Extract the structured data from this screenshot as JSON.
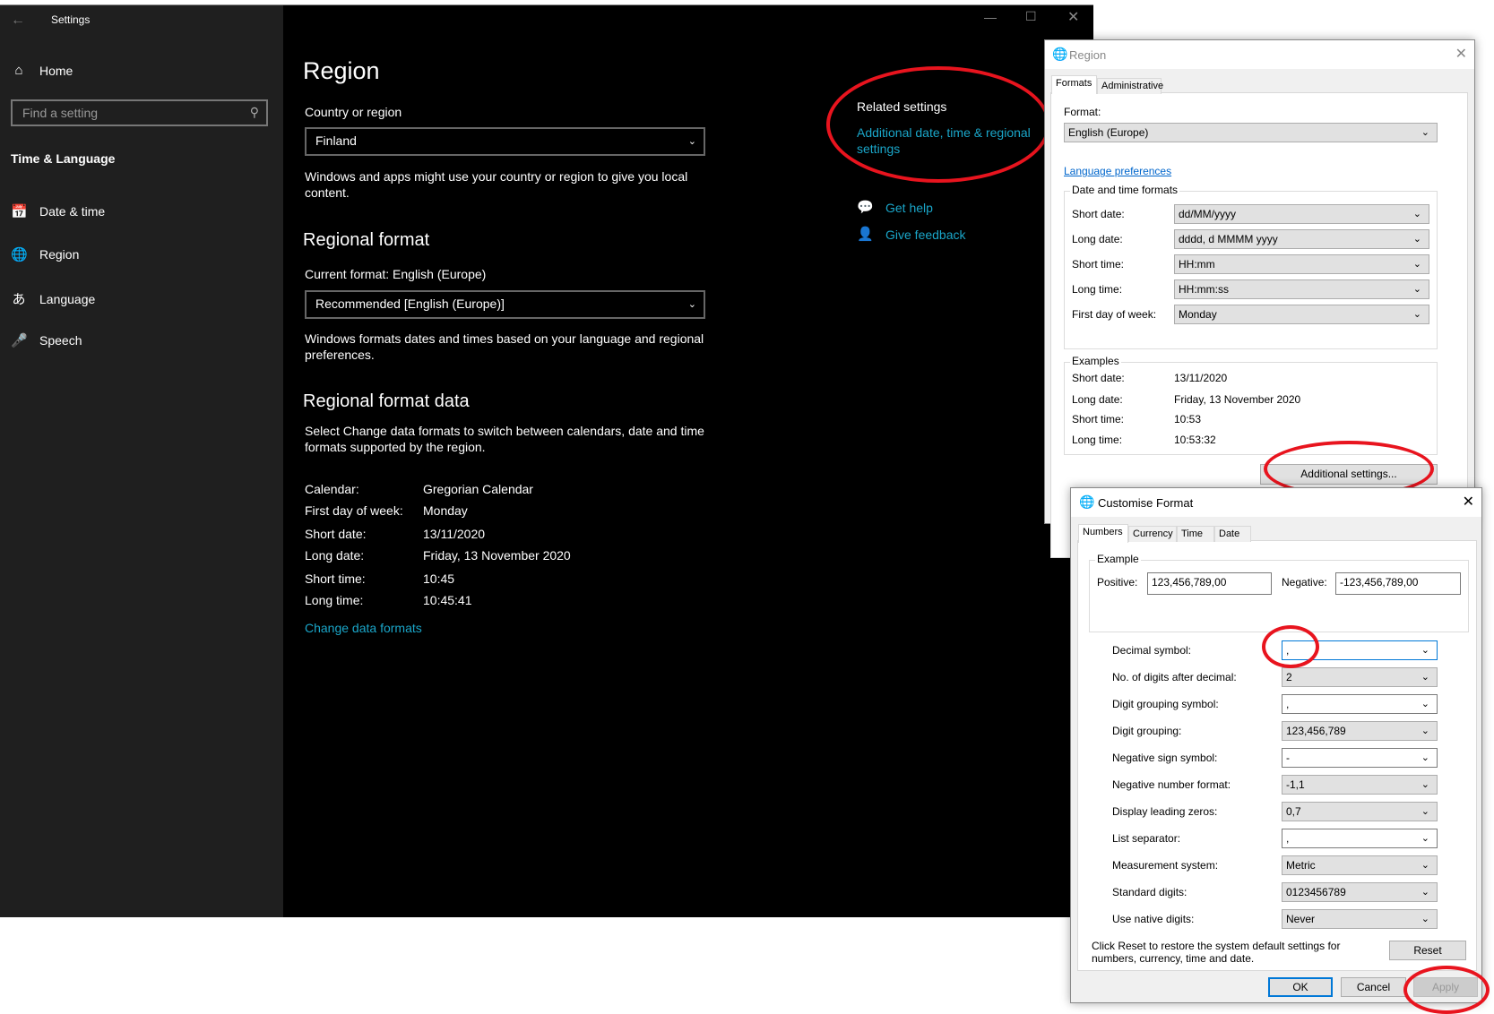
{
  "settings": {
    "title": "Settings",
    "search_placeholder": "Find a setting",
    "home": "Home",
    "section": "Time & Language",
    "nav": [
      {
        "label": "Date & time",
        "icon": "calendar-clock-icon"
      },
      {
        "label": "Region",
        "icon": "globe-icon"
      },
      {
        "label": "Language",
        "icon": "language-icon"
      },
      {
        "label": "Speech",
        "icon": "microphone-icon"
      }
    ],
    "page_title": "Region",
    "country_label": "Country or region",
    "country_value": "Finland",
    "country_desc": "Windows and apps might use your country or region to give you local content.",
    "regional_format_heading": "Regional format",
    "current_format": "Current format: English (Europe)",
    "format_value": "Recommended [English (Europe)]",
    "format_desc": "Windows formats dates and times based on your language and regional preferences.",
    "data_heading": "Regional format data",
    "data_desc": "Select Change data formats to switch between calendars, date and time formats supported by the region.",
    "data_rows": [
      {
        "k": "Calendar:",
        "v": "Gregorian Calendar"
      },
      {
        "k": "First day of week:",
        "v": "Monday"
      },
      {
        "k": "Short date:",
        "v": "13/11/2020"
      },
      {
        "k": "Long date:",
        "v": "Friday, 13 November 2020"
      },
      {
        "k": "Short time:",
        "v": "10:45"
      },
      {
        "k": "Long time:",
        "v": "10:45:41"
      }
    ],
    "change_link": "Change data formats",
    "related_heading": "Related settings",
    "related_link": "Additional date, time & regional settings",
    "get_help": "Get help",
    "give_feedback": "Give feedback"
  },
  "region_dialog": {
    "title": "Region",
    "tabs": [
      "Formats",
      "Administrative"
    ],
    "format_label": "Format:",
    "format_value": "English (Europe)",
    "lang_prefs": "Language preferences",
    "dt_group": "Date and time formats",
    "dt_rows": [
      {
        "k": "Short date:",
        "v": "dd/MM/yyyy"
      },
      {
        "k": "Long date:",
        "v": "dddd, d MMMM yyyy"
      },
      {
        "k": "Short time:",
        "v": "HH:mm"
      },
      {
        "k": "Long time:",
        "v": "HH:mm:ss"
      },
      {
        "k": "First day of week:",
        "v": "Monday"
      }
    ],
    "examples_group": "Examples",
    "examples": [
      {
        "k": "Short date:",
        "v": "13/11/2020"
      },
      {
        "k": "Long date:",
        "v": "Friday, 13 November 2020"
      },
      {
        "k": "Short time:",
        "v": "10:53"
      },
      {
        "k": "Long time:",
        "v": "10:53:32"
      }
    ],
    "additional_button": "Additional settings..."
  },
  "customise_dialog": {
    "title": "Customise Format",
    "tabs": [
      "Numbers",
      "Currency",
      "Time",
      "Date"
    ],
    "example_group": "Example",
    "positive_label": "Positive:",
    "positive_value": "123,456,789,00",
    "negative_label": "Negative:",
    "negative_value": "-123,456,789,00",
    "rows": [
      {
        "k": "Decimal symbol:",
        "v": ","
      },
      {
        "k": "No. of digits after decimal:",
        "v": "2"
      },
      {
        "k": "Digit grouping symbol:",
        "v": ","
      },
      {
        "k": "Digit grouping:",
        "v": "123,456,789"
      },
      {
        "k": "Negative sign symbol:",
        "v": "-"
      },
      {
        "k": "Negative number format:",
        "v": "-1,1"
      },
      {
        "k": "Display leading zeros:",
        "v": "0,7"
      },
      {
        "k": "List separator:",
        "v": ","
      },
      {
        "k": "Measurement system:",
        "v": "Metric"
      },
      {
        "k": "Standard digits:",
        "v": "0123456789"
      },
      {
        "k": "Use native digits:",
        "v": "Never"
      }
    ],
    "reset_text": "Click Reset to restore the system default settings for numbers, currency, time and date.",
    "reset": "Reset",
    "ok": "OK",
    "cancel": "Cancel",
    "apply": "Apply"
  }
}
